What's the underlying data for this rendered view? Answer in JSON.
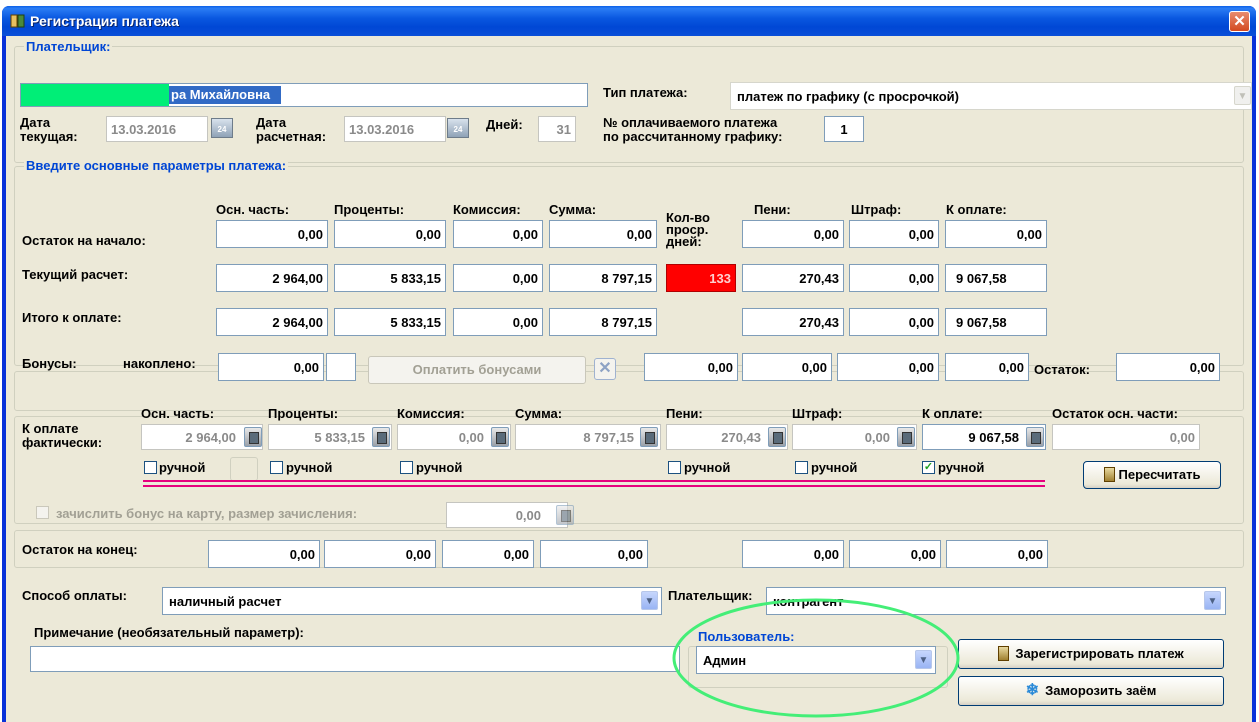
{
  "window": {
    "title": "Регистрация платежа",
    "close_label": "✕"
  },
  "payer": {
    "group_label": "Плательщик:",
    "name_value": "ра Михайловна",
    "payment_type_label": "Тип платежа:",
    "payment_type_value": "платеж по графику (с просрочкой)",
    "date_current_label_1": "Дата",
    "date_current_label_2": "текущая:",
    "date_current_value": "13.03.2016",
    "date_calc_label_1": "Дата",
    "date_calc_label_2": "расчетная:",
    "date_calc_value": "13.03.2016",
    "days_label": "Дней:",
    "days_value": "31",
    "payment_number_label_1": "№ оплачиваемого платежа",
    "payment_number_label_2": "по рассчитанному графику:",
    "payment_number_value": "1",
    "calendar_day": "24"
  },
  "params": {
    "group_label": "Введите основные параметры платежа:",
    "col_headers": {
      "principal": "Осн. часть:",
      "interest": "Проценты:",
      "commission": "Комиссия:",
      "sum": "Сумма:",
      "overdue_1": "Кол-во",
      "overdue_2": "проср.",
      "overdue_3": "дней:",
      "penalty": "Пени:",
      "fine": "Штраф:",
      "to_pay": "К оплате:"
    },
    "rows": [
      {
        "label": "Остаток на начало:",
        "principal": "0,00",
        "interest": "0,00",
        "commission": "0,00",
        "sum": "0,00",
        "penalty": "0,00",
        "fine": "0,00",
        "to_pay": "0,00"
      },
      {
        "label": "Текущий расчет:",
        "principal": "2 964,00",
        "interest": "5 833,15",
        "commission": "0,00",
        "sum": "8 797,15",
        "overdue_days": "133",
        "penalty": "270,43",
        "fine": "0,00",
        "to_pay": "9 067,58"
      },
      {
        "label": "Итого к оплате:",
        "principal": "2 964,00",
        "interest": "5 833,15",
        "commission": "0,00",
        "sum": "8 797,15",
        "penalty": "270,43",
        "fine": "0,00",
        "to_pay": "9 067,58"
      }
    ]
  },
  "bonus": {
    "label": "Бонусы:",
    "accumulated_label": "накоплено:",
    "accumulated_value": "0,00",
    "pay_button": "Оплатить бонусами",
    "clear_button": "✕",
    "penalty": "0,00",
    "fine": "0,00",
    "v3": "0,00",
    "v4": "0,00",
    "to_pay": "0,00",
    "remainder_label": "Остаток:",
    "remainder_value": "0,00"
  },
  "actual": {
    "label_1": "К оплате",
    "label_2": "фактически:",
    "headers": {
      "principal": "Осн. часть:",
      "interest": "Проценты:",
      "commission": "Комиссия:",
      "sum": "Сумма:",
      "penalty": "Пени:",
      "fine": "Штраф:",
      "to_pay": "К оплате:",
      "principal_left": "Остаток осн. части:"
    },
    "values": {
      "principal": "2 964,00",
      "interest": "5 833,15",
      "commission": "0,00",
      "sum": "8 797,15",
      "penalty": "270,43",
      "fine": "0,00",
      "to_pay": "9 067,58",
      "principal_left": "0,00"
    },
    "manual_label": "ручной",
    "checked_mark": "✓",
    "recalc_button": "Пересчитать"
  },
  "bonus_card": {
    "label": "зачислить бонус на карту, размер зачисления:",
    "value": "0,00"
  },
  "end_balance": {
    "label": "Остаток на конец:",
    "principal": "0,00",
    "interest": "0,00",
    "commission": "0,00",
    "sum": "0,00",
    "penalty": "0,00",
    "fine": "0,00",
    "to_pay": "0,00"
  },
  "bottom": {
    "payment_method_label": "Способ оплаты:",
    "payment_method_value": "наличный расчет",
    "payer_label": "Плательщик:",
    "payer_value": "контрагент",
    "note_label": "Примечание (необязательный параметр):",
    "note_value": "",
    "user_label": "Пользователь:",
    "user_value": "Админ",
    "register_button": "Зарегистрировать платеж",
    "freeze_button": "Заморозить заём"
  },
  "colors": {
    "highlight_red": "#ff0000",
    "pink_mark": "#e6007e",
    "green_mark": "#44ee77",
    "name_mask": "#00ee77"
  }
}
